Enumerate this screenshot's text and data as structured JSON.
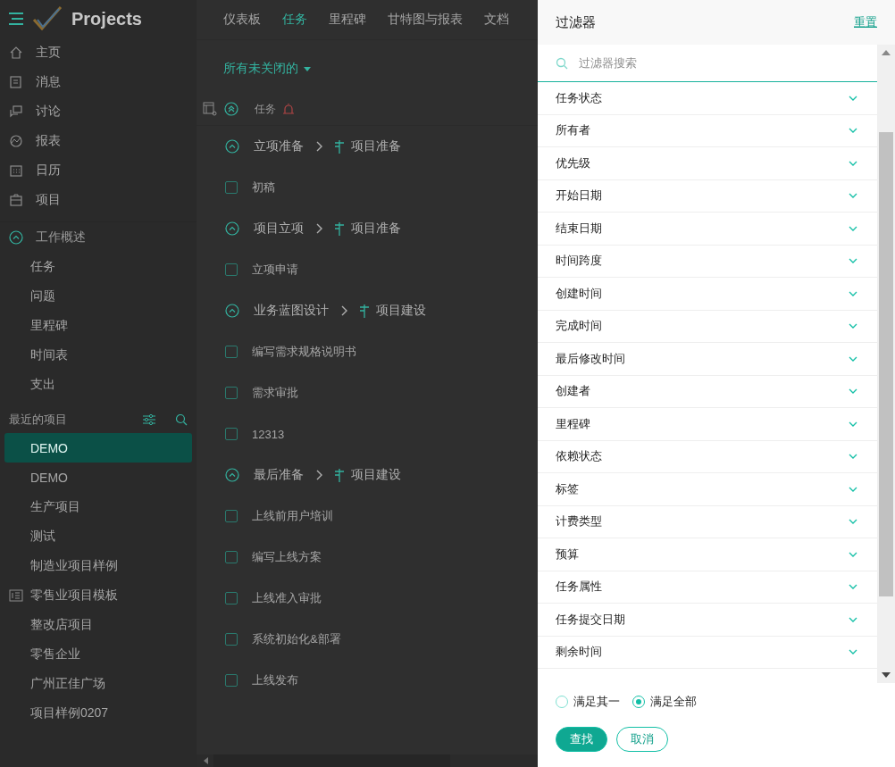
{
  "app": {
    "name": "Projects"
  },
  "sidebar": {
    "nav": [
      {
        "label": "主页"
      },
      {
        "label": "消息"
      },
      {
        "label": "讨论"
      },
      {
        "label": "报表"
      },
      {
        "label": "日历"
      },
      {
        "label": "项目"
      }
    ],
    "section": {
      "label": "工作概述",
      "items": [
        {
          "label": "任务"
        },
        {
          "label": "问题"
        },
        {
          "label": "里程碑"
        },
        {
          "label": "时间表"
        },
        {
          "label": "支出"
        }
      ]
    },
    "recent": {
      "label": "最近的项目",
      "items": [
        {
          "label": "DEMO",
          "selected": true,
          "kind": "project"
        },
        {
          "label": "DEMO",
          "selected": false,
          "kind": "project"
        },
        {
          "label": "生产项目",
          "selected": false,
          "kind": "project"
        },
        {
          "label": "测试",
          "selected": false,
          "kind": "project"
        },
        {
          "label": "制造业项目样例",
          "selected": false,
          "kind": "project"
        },
        {
          "label": "零售业项目模板",
          "selected": false,
          "kind": "template"
        },
        {
          "label": "整改店项目",
          "selected": false,
          "kind": "project"
        },
        {
          "label": "零售企业",
          "selected": false,
          "kind": "project"
        },
        {
          "label": "广州正佳广场",
          "selected": false,
          "kind": "project"
        },
        {
          "label": "项目样例0207",
          "selected": false,
          "kind": "project"
        }
      ]
    }
  },
  "tabs": [
    {
      "label": "仪表板",
      "selected": false
    },
    {
      "label": "任务",
      "selected": true
    },
    {
      "label": "里程碑",
      "selected": false
    },
    {
      "label": "甘特图与报表",
      "selected": false
    },
    {
      "label": "文档",
      "selected": false
    }
  ],
  "view_filter": "所有未关闭的",
  "table": {
    "column": "任务",
    "groups": [
      {
        "name": "立项准备",
        "milestone": "项目准备",
        "tasks": [
          {
            "name": "初稿",
            "checked": false
          }
        ]
      },
      {
        "name": "项目立项",
        "milestone": "项目准备",
        "tasks": [
          {
            "name": "立项申请",
            "checked": false
          }
        ]
      },
      {
        "name": "业务蓝图设计",
        "milestone": "项目建设",
        "tasks": [
          {
            "name": "编写需求规格说明书",
            "checked": false
          },
          {
            "name": "需求审批",
            "checked": false
          },
          {
            "name": "12313",
            "checked": false
          }
        ]
      },
      {
        "name": "最后准备",
        "milestone": "项目建设",
        "tasks": [
          {
            "name": "上线前用户培训",
            "checked": false
          },
          {
            "name": "编写上线方案",
            "checked": false
          },
          {
            "name": "上线准入审批",
            "checked": false
          },
          {
            "name": "系统初始化&部署",
            "checked": false
          },
          {
            "name": "上线发布",
            "checked": false
          }
        ]
      }
    ]
  },
  "filter_panel": {
    "title": "过滤器",
    "reset": "重置",
    "search": {
      "placeholder": "过滤器搜索"
    },
    "fields": [
      "任务状态",
      "所有者",
      "优先级",
      "开始日期",
      "结束日期",
      "时间跨度",
      "创建时间",
      "完成时间",
      "最后修改时间",
      "创建者",
      "里程碑",
      "依赖状态",
      "标签",
      "计费类型",
      "预算",
      "任务属性",
      "任务提交日期",
      "剩余时间"
    ],
    "match": [
      {
        "label": "满足其一",
        "selected": false
      },
      {
        "label": "满足全部",
        "selected": true
      }
    ],
    "buttons": [
      {
        "label": "查找",
        "kind": "primary"
      },
      {
        "label": "取消",
        "kind": "secondary"
      }
    ]
  }
}
